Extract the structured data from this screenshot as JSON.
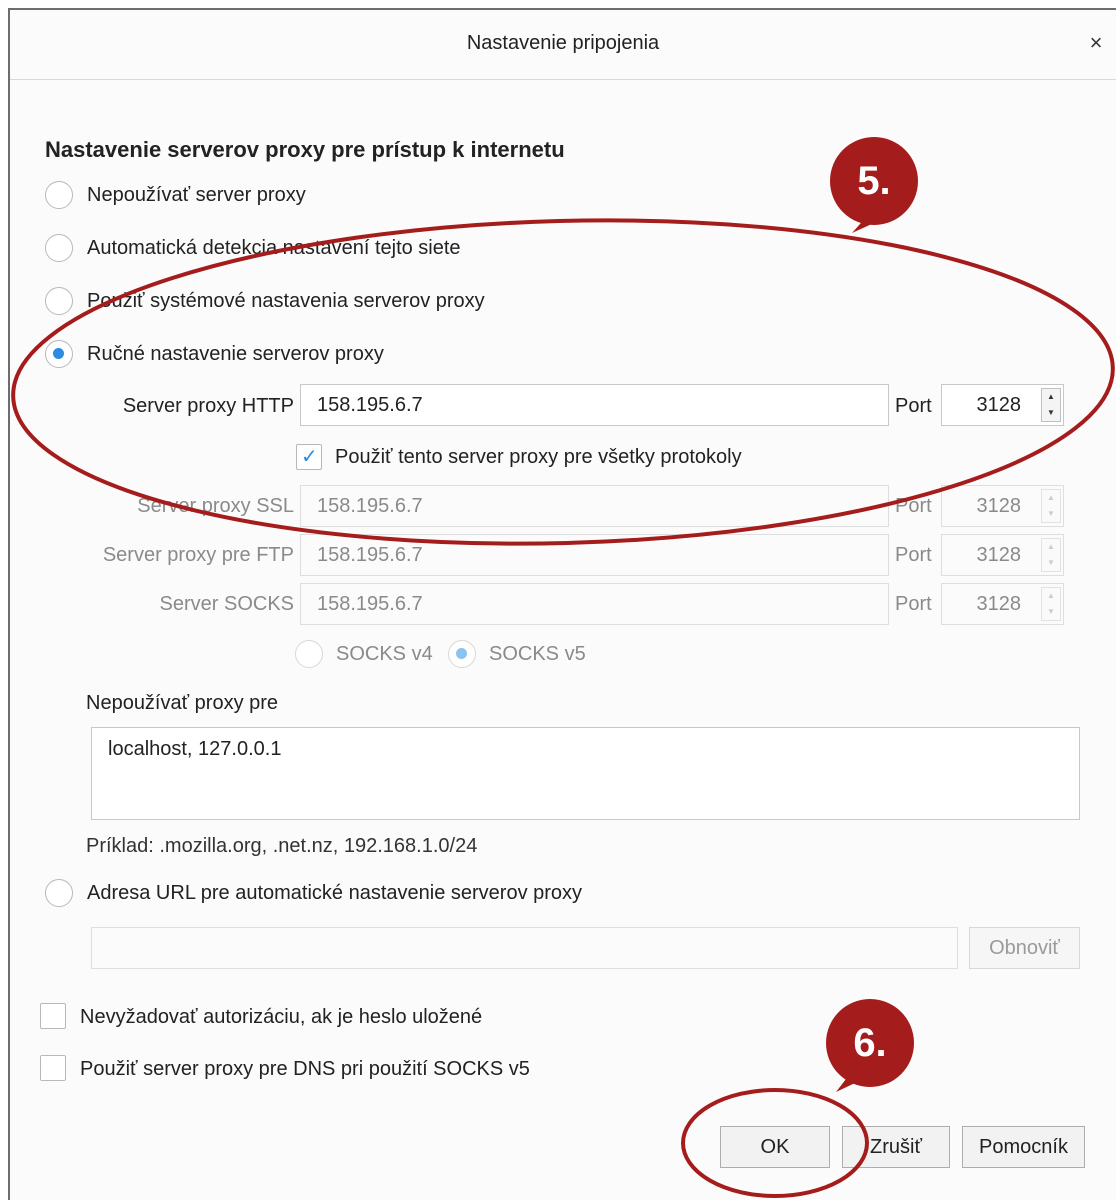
{
  "dialog": {
    "title": "Nastavenie pripojenia",
    "close_icon": "×"
  },
  "proxy": {
    "heading": "Nastavenie serverov proxy pre prístup k internetu",
    "options": [
      "Nepoužívať server proxy",
      "Automatická detekcia nastavení tejto siete",
      "Použiť systémové nastavenia serverov proxy",
      "Ručné nastavenie serverov proxy"
    ],
    "selected_option": "Ručné nastavenie serverov proxy",
    "http": {
      "label": "Server proxy HTTP",
      "value": "158.195.6.7",
      "port_label": "Port",
      "port": "3128"
    },
    "use_for_all": {
      "label": "Použiť tento server proxy pre všetky protokoly",
      "checked": true
    },
    "ssl": {
      "label": "Server proxy SSL",
      "value": "158.195.6.7",
      "port_label": "Port",
      "port": "3128"
    },
    "ftp": {
      "label": "Server proxy pre FTP",
      "value": "158.195.6.7",
      "port_label": "Port",
      "port": "3128"
    },
    "socks": {
      "label": "Server SOCKS",
      "value": "158.195.6.7",
      "port_label": "Port",
      "port": "3128"
    },
    "socks_versions": [
      "SOCKS v4",
      "SOCKS v5"
    ],
    "socks_selected": "SOCKS v5",
    "no_proxy_label": "Nepoužívať proxy pre",
    "no_proxy_value": "localhost, 127.0.0.1",
    "example": "Príklad: .mozilla.org, .net.nz, 192.168.1.0/24",
    "auto_url_label": "Adresa URL pre automatické nastavenie serverov proxy",
    "auto_url_value": "",
    "reload_label": "Obnoviť"
  },
  "checkboxes": {
    "no_auth": {
      "label": "Nevyžadovať autorizáciu, ak je heslo uložené",
      "checked": false
    },
    "dns_socks": {
      "label": "Použiť server proxy pre DNS pri použití SOCKS v5",
      "checked": false
    }
  },
  "buttons": {
    "ok": "OK",
    "cancel": "Zrušiť",
    "help": "Pomocník"
  },
  "annotations": {
    "step5": "5.",
    "step6": "6.",
    "color": "#a51c1c"
  }
}
